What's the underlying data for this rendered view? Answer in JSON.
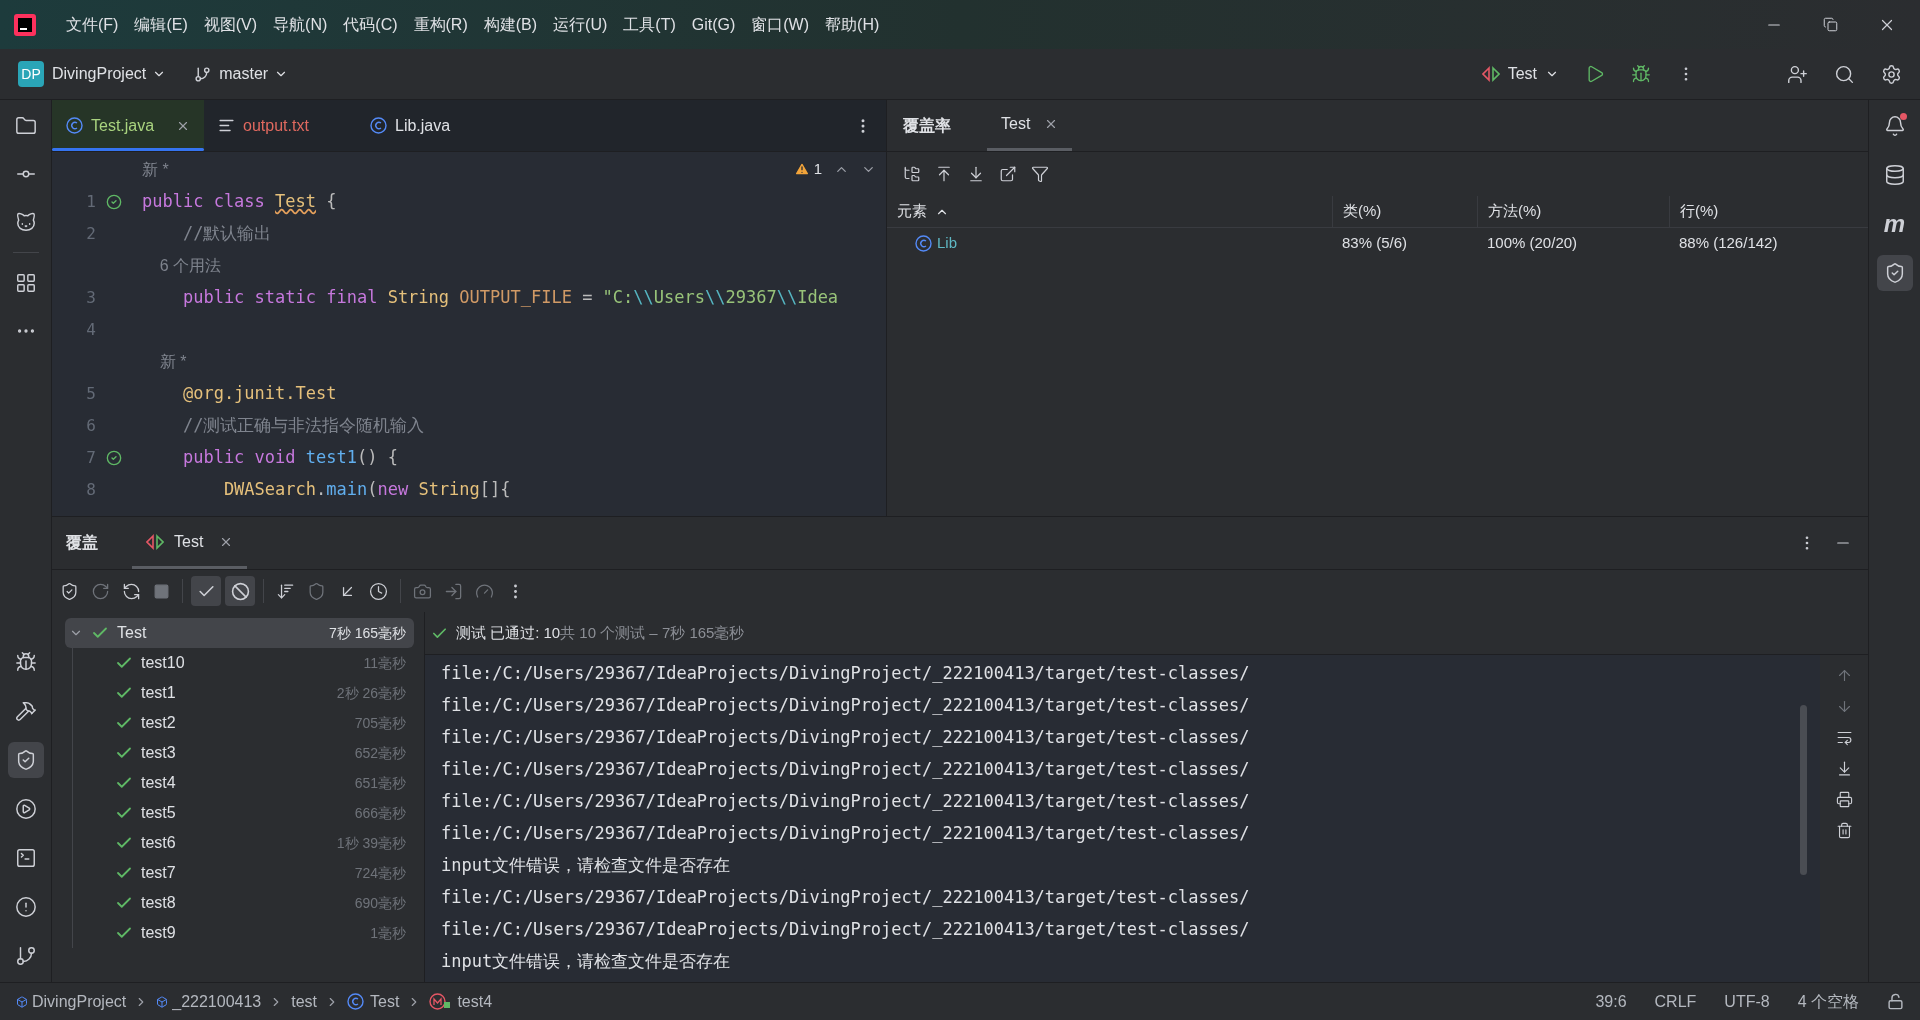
{
  "menu": [
    "文件(F)",
    "编辑(E)",
    "视图(V)",
    "导航(N)",
    "代码(C)",
    "重构(R)",
    "构建(B)",
    "运行(U)",
    "工具(T)",
    "Git(G)",
    "窗口(W)",
    "帮助(H)"
  ],
  "toolbar": {
    "project_badge": "DP",
    "project": "DivingProject",
    "branch": "master",
    "run_config": "Test"
  },
  "left_stripe": [
    {
      "kind": "folder",
      "selected": false
    },
    {
      "kind": "commit",
      "selected": false
    },
    {
      "kind": "gitlab",
      "selected": false
    },
    {
      "kind": "structure",
      "selected": false
    },
    {
      "kind": "more",
      "selected": false
    }
  ],
  "left_stripe_bottom": [
    {
      "kind": "debug",
      "selected": false
    },
    {
      "kind": "build",
      "selected": false
    },
    {
      "kind": "coverage",
      "selected": true
    },
    {
      "kind": "services",
      "selected": false
    },
    {
      "kind": "terminal",
      "selected": false
    },
    {
      "kind": "problems",
      "selected": false
    },
    {
      "kind": "git",
      "selected": false
    }
  ],
  "right_stripe": [
    {
      "kind": "notifications",
      "selected": false,
      "unread": true
    },
    {
      "kind": "database",
      "selected": false,
      "unread": false
    },
    {
      "kind": "maven",
      "label": "m",
      "selected": false,
      "unread": false
    },
    {
      "kind": "coverage",
      "selected": true,
      "unread": false
    }
  ],
  "editor": {
    "tabs": [
      {
        "label": "Test.java",
        "kind": "class",
        "selected": true,
        "error": false
      },
      {
        "label": "output.txt",
        "kind": "text",
        "selected": false,
        "error": true
      },
      {
        "label": "Lib.java",
        "kind": "class",
        "selected": false,
        "error": false
      }
    ],
    "warnings": "1",
    "lines": [
      {
        "kind": "hint",
        "text": "新 *"
      },
      {
        "kind": "code",
        "number": "1",
        "run": true,
        "tokens": [
          {
            "kind": "kw",
            "text": "public class "
          },
          {
            "kind": "cls",
            "text": "Test"
          },
          {
            "kind": "plain",
            "text": " {"
          }
        ]
      },
      {
        "kind": "code",
        "number": "2",
        "run": false,
        "tokens": [
          {
            "kind": "comment",
            "text": "    //默认输出"
          }
        ]
      },
      {
        "kind": "hint",
        "text": "    6 个用法"
      },
      {
        "kind": "code",
        "number": "3",
        "run": false,
        "tokens": [
          {
            "kind": "kw",
            "text": "    public static final "
          },
          {
            "kind": "type",
            "text": "String "
          },
          {
            "kind": "field",
            "text": "OUTPUT_FILE"
          },
          {
            "kind": "plain",
            "text": " = "
          },
          {
            "kind": "str",
            "text": "\"C:"
          },
          {
            "kind": "esc",
            "text": "\\\\"
          },
          {
            "kind": "str",
            "text": "Users"
          },
          {
            "kind": "esc",
            "text": "\\\\"
          },
          {
            "kind": "str",
            "text": "29367"
          },
          {
            "kind": "esc",
            "text": "\\\\"
          },
          {
            "kind": "str",
            "text": "Idea"
          }
        ]
      },
      {
        "kind": "code",
        "number": "4",
        "run": false
      },
      {
        "kind": "hint",
        "text": "    新 *"
      },
      {
        "kind": "code",
        "number": "5",
        "run": false,
        "tokens": [
          {
            "kind": "ann",
            "text": "    @org.junit.Test"
          }
        ]
      },
      {
        "kind": "code",
        "number": "6",
        "run": false,
        "tokens": [
          {
            "kind": "comment",
            "text": "    //测试正确与非法指令随机输入"
          }
        ]
      },
      {
        "kind": "code",
        "number": "7",
        "run": true,
        "tokens": [
          {
            "kind": "kw",
            "text": "    public void "
          },
          {
            "kind": "fn",
            "text": "test1"
          },
          {
            "kind": "plain",
            "text": "() {"
          }
        ]
      },
      {
        "kind": "code",
        "number": "8",
        "run": false,
        "tokens": [
          {
            "kind": "type",
            "text": "        DWASearch"
          },
          {
            "kind": "plain",
            "text": "."
          },
          {
            "kind": "fn",
            "text": "main"
          },
          {
            "kind": "plain",
            "text": "("
          },
          {
            "kind": "kw",
            "text": "new "
          },
          {
            "kind": "type",
            "text": "String"
          },
          {
            "kind": "plain",
            "text": "[]{"
          }
        ]
      }
    ]
  },
  "coverage": {
    "title": "覆盖率",
    "tabs": [
      {
        "label": "Test",
        "selected": true
      }
    ],
    "columns": [
      "元素",
      "类(%)",
      "方法(%)",
      "行(%)"
    ],
    "rows": [
      {
        "name": "Lib",
        "class": "83% (5/6)",
        "method": "100% (20/20)",
        "line": "88% (126/142)"
      }
    ]
  },
  "run": {
    "title": "覆盖",
    "tabs": [
      {
        "label": "Test",
        "selected": true
      }
    ],
    "filters": [
      {
        "kind": "passed",
        "selected": true
      },
      {
        "kind": "ignored",
        "selected": true
      }
    ],
    "tree": {
      "name": "Test",
      "time": "7秒 165毫秒",
      "passed": true,
      "expanded": true,
      "selected": true,
      "children": [
        {
          "name": "test10",
          "time": "11毫秒",
          "passed": true,
          "selected": false
        },
        {
          "name": "test1",
          "time": "2秒 26毫秒",
          "passed": true,
          "selected": false
        },
        {
          "name": "test2",
          "time": "705毫秒",
          "passed": true,
          "selected": false
        },
        {
          "name": "test3",
          "time": "652毫秒",
          "passed": true,
          "selected": false
        },
        {
          "name": "test4",
          "time": "651毫秒",
          "passed": true,
          "selected": false
        },
        {
          "name": "test5",
          "time": "666毫秒",
          "passed": true,
          "selected": false
        },
        {
          "name": "test6",
          "time": "1秒 39毫秒",
          "passed": true,
          "selected": false
        },
        {
          "name": "test7",
          "time": "724毫秒",
          "passed": true,
          "selected": false
        },
        {
          "name": "test8",
          "time": "690毫秒",
          "passed": true,
          "selected": false
        },
        {
          "name": "test9",
          "time": "1毫秒",
          "passed": true,
          "selected": false
        }
      ]
    },
    "summary": "测试 已通过: 10",
    "summary_detail": "共 10 个测试 – 7秒 165毫秒",
    "console": [
      "file:/C:/Users/29367/IdeaProjects/DivingProject/_222100413/target/test-classes/",
      "file:/C:/Users/29367/IdeaProjects/DivingProject/_222100413/target/test-classes/",
      "file:/C:/Users/29367/IdeaProjects/DivingProject/_222100413/target/test-classes/",
      "file:/C:/Users/29367/IdeaProjects/DivingProject/_222100413/target/test-classes/",
      "file:/C:/Users/29367/IdeaProjects/DivingProject/_222100413/target/test-classes/",
      "file:/C:/Users/29367/IdeaProjects/DivingProject/_222100413/target/test-classes/",
      "input文件错误，请检查文件是否存在",
      "file:/C:/Users/29367/IdeaProjects/DivingProject/_222100413/target/test-classes/",
      "file:/C:/Users/29367/IdeaProjects/DivingProject/_222100413/target/test-classes/",
      "input文件错误，请检查文件是否存在"
    ]
  },
  "status_bar": {
    "breadcrumbs": [
      {
        "label": "DivingProject",
        "kind": "project"
      },
      {
        "label": "_222100413",
        "kind": "module"
      },
      {
        "label": "test",
        "kind": "folder"
      },
      {
        "label": "Test",
        "kind": "class"
      },
      {
        "label": "test4",
        "kind": "method"
      }
    ],
    "items": [
      "39:6",
      "CRLF",
      "UTF-8",
      "4 个空格"
    ]
  }
}
